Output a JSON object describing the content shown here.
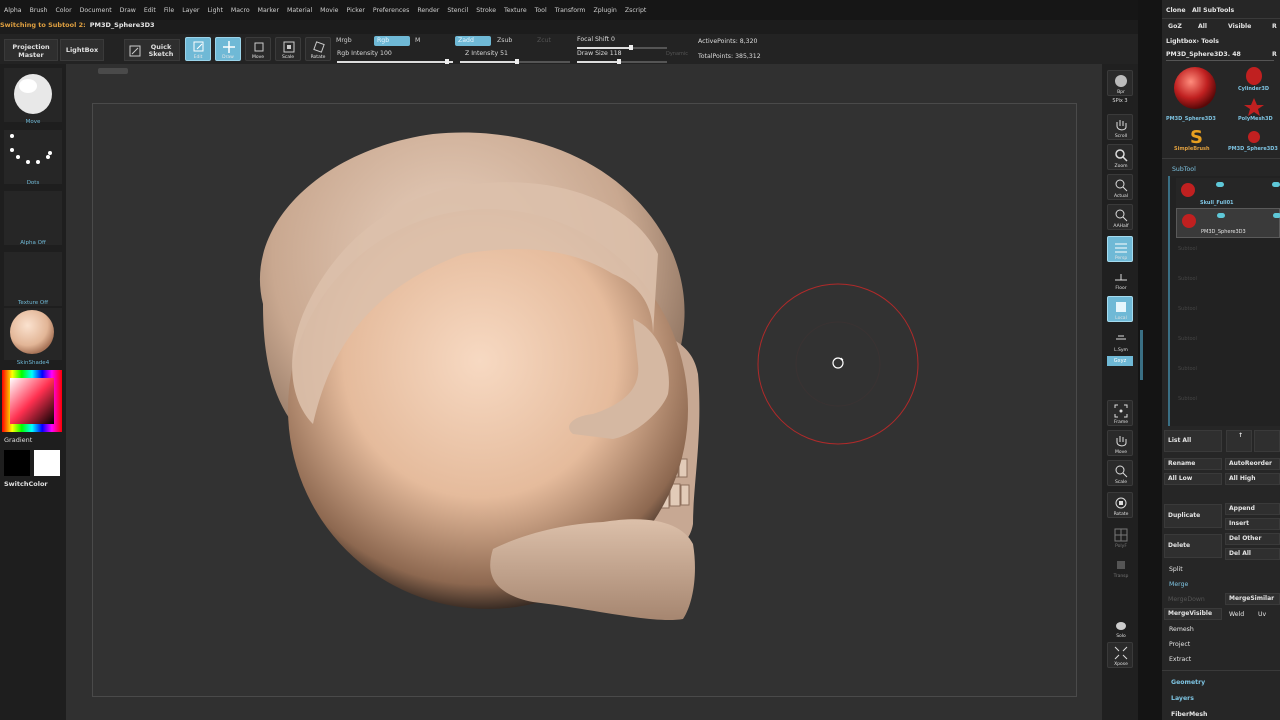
{
  "menubar": {
    "items": [
      "Alpha",
      "Brush",
      "Color",
      "Document",
      "Draw",
      "Edit",
      "File",
      "Layer",
      "Light",
      "Macro",
      "Marker",
      "Material",
      "Movie",
      "Picker",
      "Preferences",
      "Render",
      "Stencil",
      "Stroke",
      "Texture",
      "Tool",
      "Transform",
      "Zplugin",
      "Zscript"
    ]
  },
  "status": {
    "prefix": "Switching to Subtool 2:",
    "subtool": "PM3D_Sphere3D3"
  },
  "toolbar": {
    "projection_master": "Projection Master",
    "lightbox": "LightBox",
    "quick_sketch": "Quick Sketch",
    "edit": "Edit",
    "draw": "Draw",
    "move": "Move",
    "scale": "Scale",
    "rotate": "Rotate",
    "mrgb": "Mrgb",
    "rgb": "Rgb",
    "m": "M",
    "zadd": "Zadd",
    "zsub": "Zsub",
    "zcut": "Zcut",
    "rgb_intensity": "Rgb Intensity 100",
    "z_intensity": "Z Intensity 51",
    "focal_shift": "Focal Shift 0",
    "draw_size": "Draw Size 118",
    "dynamic": "Dynamic",
    "active_points": "ActivePoints: 8,320",
    "total_points": "TotalPoints: 385,312"
  },
  "left_shelf": {
    "brush_label": "Move",
    "stroke_label": "Dots",
    "alpha_label": "Alpha Off",
    "texture_label": "Texture Off",
    "material_label": "SkinShade4",
    "gradient_label": "Gradient",
    "switch_color": "SwitchColor"
  },
  "right_shelf": {
    "buttons": [
      "Bpr",
      "SPix 3",
      "Scroll",
      "Zoom",
      "Actual",
      "AAHalf",
      "Persp",
      "Floor",
      "Local",
      "L.Sym",
      "Gxyz",
      "Frame",
      "Move",
      "Scale",
      "Rotate",
      "PolyF",
      "Transp",
      "Solo",
      "Xpose"
    ]
  },
  "palette": {
    "header1": "Clone",
    "header2": "All SubTools",
    "goz": "GoZ",
    "all": "All",
    "visible": "Visible",
    "r": "R",
    "lightbox_tools": "Lightbox› Tools",
    "tool_name": "PM3D_Sphere3D3. 48",
    "r2": "R",
    "tools": [
      "PM3D_Sphere3D3",
      "Cylinder3D",
      "PolyMesh3D",
      "SimpleBrush",
      "PM3D_Sphere3D3"
    ],
    "subtool_title": "SubTool",
    "subtools": [
      "Skull_Full01",
      "PM3D_Sphere3D3"
    ],
    "empty_slots": [
      "Subtool",
      "Subtool",
      "Subtool",
      "Subtool",
      "Subtool",
      "Subtool"
    ],
    "list_all": "List All",
    "rename": "Rename",
    "auto_reorder": "AutoReorder",
    "all_low": "All Low",
    "all_high": "All High",
    "duplicate": "Duplicate",
    "append": "Append",
    "insert": "Insert",
    "delete": "Delete",
    "del_other": "Del Other",
    "del_all": "Del All",
    "split": "Split",
    "merge": "Merge",
    "merge_down": "MergeDown",
    "merge_similar": "MergeSimilar",
    "merge_visible": "MergeVisible",
    "weld": "Weld",
    "uv": "Uv",
    "remesh": "Remesh",
    "project": "Project",
    "extract": "Extract",
    "geometry": "Geometry",
    "layers": "Layers",
    "fibermesh": "FiberMesh"
  },
  "colors": {
    "accent": "#6fb9d6",
    "skull": "#d7b9a4",
    "sphere": "#e8c4a8",
    "brush_ring": "#b02a2a"
  }
}
